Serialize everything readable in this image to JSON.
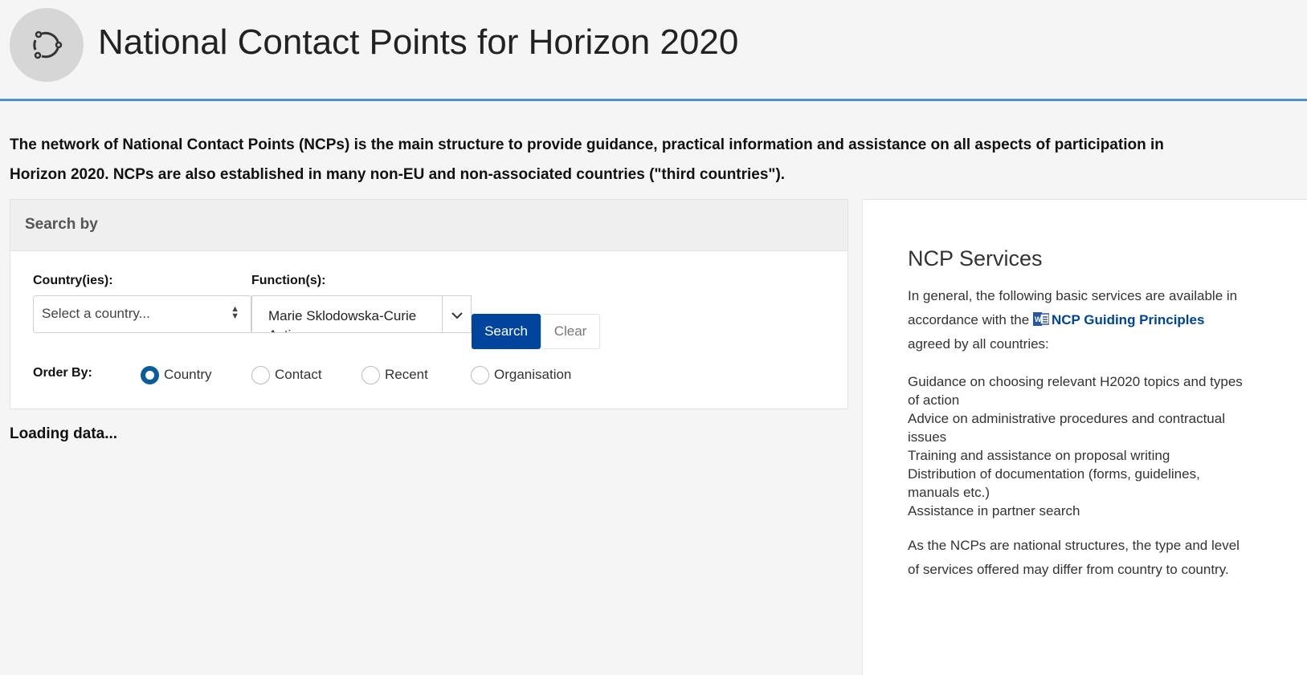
{
  "header": {
    "title": "National Contact Points for Horizon 2020",
    "icon": "circular-arrows-icon"
  },
  "intro": {
    "line1": "The network of National Contact Points (NCPs) is the main structure to provide guidance, practical information and assistance on all aspects of participation in",
    "line2": "Horizon 2020. NCPs are also established in many non-EU and non-associated countries (\"third countries\")."
  },
  "search": {
    "panel_title": "Search by",
    "country_label": "Country(ies):",
    "country_placeholder": "Select a country...",
    "function_label": "Function(s):",
    "function_value": "Marie Sklodowska-Curie Actions",
    "search_button": "Search",
    "clear_button": "Clear",
    "order_by_label": "Order By:",
    "order_options": [
      {
        "label": "Country",
        "selected": true
      },
      {
        "label": "Contact",
        "selected": false
      },
      {
        "label": "Recent",
        "selected": false
      },
      {
        "label": "Organisation",
        "selected": false
      }
    ]
  },
  "status": {
    "loading": "Loading data..."
  },
  "services": {
    "title": "NCP Services",
    "intro_before": "In general, the following basic services are available in accordance with the",
    "link_label": "NCP Guiding Principles",
    "intro_after": "agreed by all countries:",
    "items": [
      "Guidance on choosing relevant H2020 topics and types of action",
      "Advice on administrative procedures and contractual issues",
      "Training and assistance on proposal writing",
      "Distribution of documentation (forms, guidelines, manuals etc.)",
      "Assistance in partner search"
    ],
    "closing": "As the NCPs are national structures, the type and level of services offered may differ from country to country."
  },
  "colors": {
    "accent_line": "#4a94c9",
    "primary_button": "#00449e",
    "radio_selected": "#0b5d9a",
    "link": "#004494"
  }
}
